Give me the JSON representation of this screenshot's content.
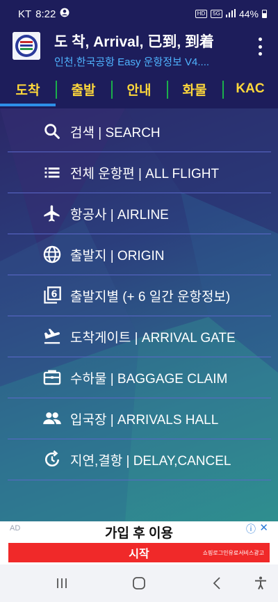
{
  "status_bar": {
    "carrier": "KT",
    "time": "8:22",
    "network_hd": "HD",
    "network_5g": "5G",
    "battery": "44%"
  },
  "app_bar": {
    "title": "도 착, Arrival, 已到, 到着",
    "subtitle": "인천,한국공항 Easy 운항정보 V4...."
  },
  "tabs": [
    {
      "label": "도착",
      "active": true
    },
    {
      "label": "출발",
      "active": false
    },
    {
      "label": "안내",
      "active": false
    },
    {
      "label": "화물",
      "active": false
    },
    {
      "label": "KAC",
      "active": false
    }
  ],
  "menu": [
    {
      "label": "검색 | SEARCH",
      "icon": "search-icon"
    },
    {
      "label": "전체 운항편 | ALL FLIGHT",
      "icon": "list-icon"
    },
    {
      "label": "항공사 | AIRLINE",
      "icon": "airplane-icon"
    },
    {
      "label": "출발지 | ORIGIN",
      "icon": "globe-icon"
    },
    {
      "label": "출발지별 (+ 6 일간 운항정보)",
      "icon": "filter-6-icon"
    },
    {
      "label": "도착게이트 | ARRIVAL GATE",
      "icon": "flight-land-icon"
    },
    {
      "label": "수하물 | BAGGAGE CLAIM",
      "icon": "luggage-icon"
    },
    {
      "label": "입국장 | ARRIVALS HALL",
      "icon": "people-icon"
    },
    {
      "label": "지연,결항 | DELAY,CANCEL",
      "icon": "refresh-clock-icon"
    }
  ],
  "ad": {
    "tag": "AD",
    "title": "가입 후 이용",
    "cta": "시작",
    "cta_sub": "쇼핑로그인유료서비스광고"
  },
  "colors": {
    "bar_bg": "#1d1d5b",
    "tab_text": "#ffd83b",
    "tab_divider": "#1bb04b",
    "tab_indicator": "#2d8fe8",
    "subtitle": "#4fb3ff",
    "ad_cta": "#f02929"
  }
}
